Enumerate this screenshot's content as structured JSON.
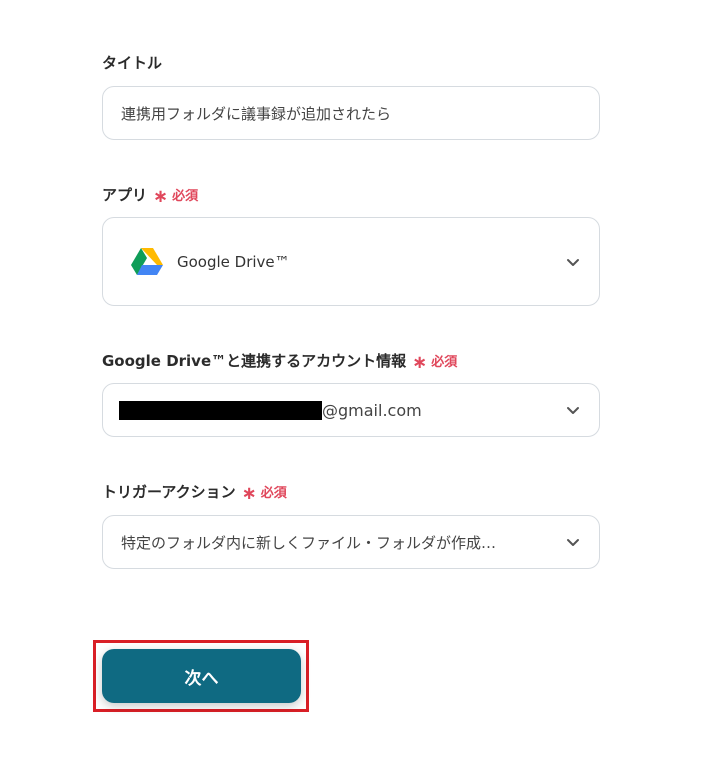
{
  "form": {
    "title_label": "タイトル",
    "title_value": "連携用フォルダに議事録が追加されたら",
    "app_label": "アプリ",
    "app_required": "必須",
    "app_value": "Google Drive™",
    "account_label": "Google Drive™と連携するアカウント情報",
    "account_required": "必須",
    "account_domain": "@gmail.com",
    "trigger_label": "トリガーアクション",
    "trigger_required": "必須",
    "trigger_value": "特定のフォルダ内に新しくファイル・フォルダが作成…",
    "next_button": "次へ"
  },
  "icons": {
    "app_logo": "google-drive-icon",
    "chevron": "chevron-down-icon",
    "required_mark": "asterisk-icon"
  },
  "colors": {
    "primary": "#0f6a82",
    "required": "#e0475b",
    "highlight": "#d91f26"
  }
}
